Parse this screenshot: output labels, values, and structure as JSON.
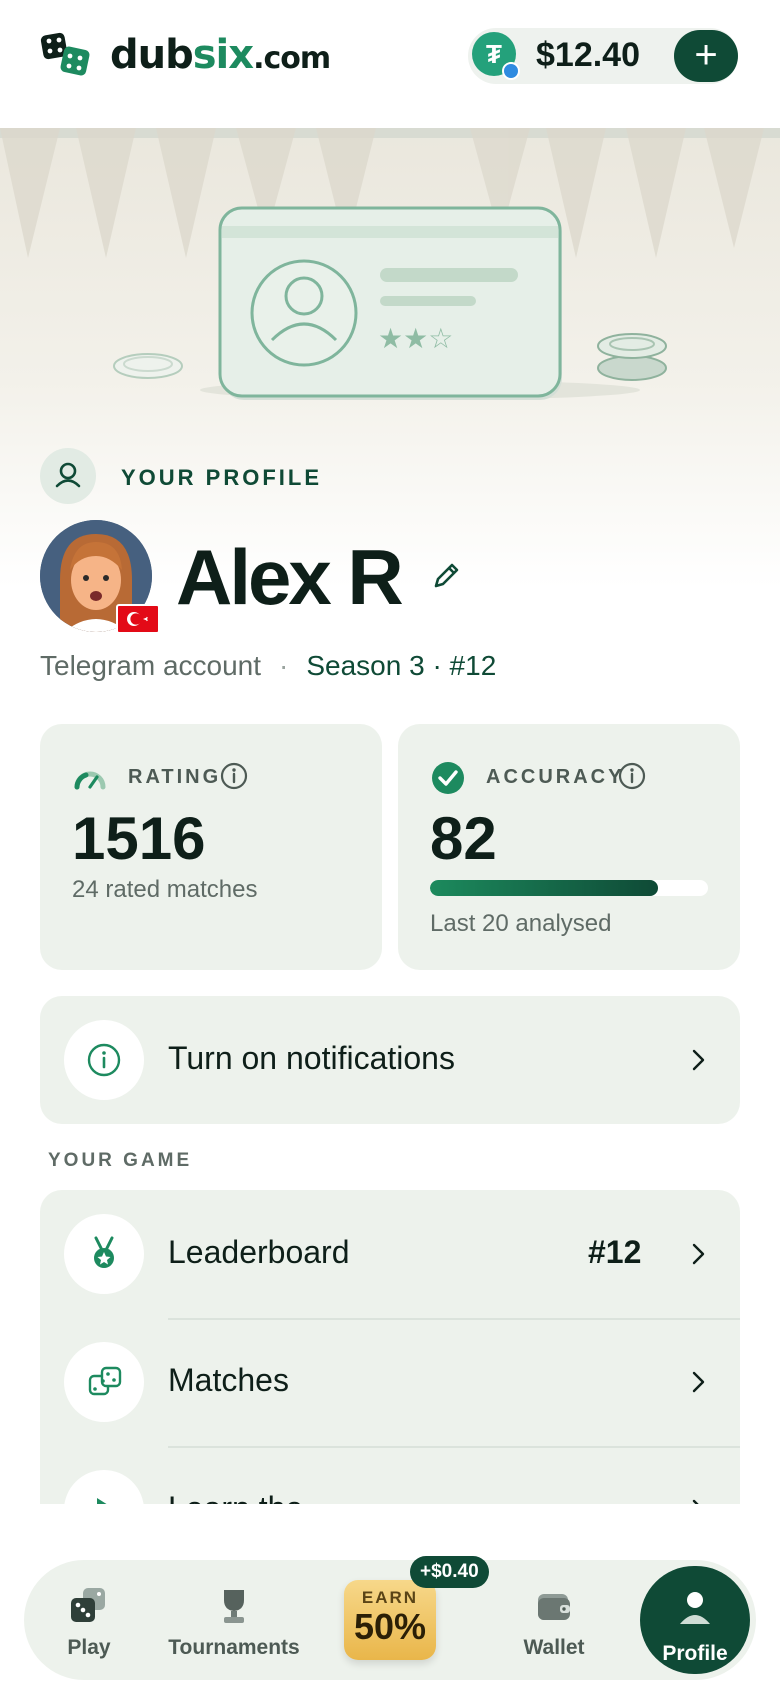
{
  "header": {
    "logo": {
      "name_main": "dub",
      "name_accent": "six",
      "name_suffix": ".com"
    },
    "balance": {
      "amount": "$12.40",
      "currency_icon": "tether-icon",
      "add_label": "+"
    }
  },
  "hero": {
    "illustration": "profile-card-illustration"
  },
  "profile": {
    "kicker": "YOUR PROFILE",
    "name": "Alex R",
    "flag": "turkey-flag",
    "account_type": "Telegram account",
    "separator": "·",
    "season": "Season 3 · #12"
  },
  "stats": {
    "rating": {
      "label": "RATING",
      "value": "1516",
      "sub": "24 rated matches"
    },
    "accuracy": {
      "label": "ACCURACY",
      "value": "82",
      "progress": 0.82,
      "sub": "Last 20 analysed"
    }
  },
  "notifications": {
    "label": "Turn on notifications"
  },
  "your_game": {
    "title": "YOUR GAME",
    "items": [
      {
        "label": "Leaderboard",
        "value": "#12",
        "icon": "medal-icon"
      },
      {
        "label": "Matches",
        "value": "",
        "icon": "dice-icon"
      },
      {
        "label": "Learn the…",
        "value": "",
        "icon": "play-icon"
      }
    ]
  },
  "nav": {
    "items": [
      {
        "label": "Play",
        "icon": "dice-icon"
      },
      {
        "label": "Tournaments",
        "icon": "trophy-icon"
      },
      {
        "label": "Wallet",
        "icon": "wallet-icon"
      },
      {
        "label": "Profile",
        "icon": "user-icon"
      }
    ],
    "earn": {
      "top": "EARN",
      "value": "50%",
      "badge": "+$0.40"
    }
  },
  "colors": {
    "brand_dark": "#0f4a36",
    "brand_green": "#1d8a5f",
    "card_bg": "#edf2ec",
    "text": "#0e1f19",
    "muted": "#5f6b66"
  }
}
